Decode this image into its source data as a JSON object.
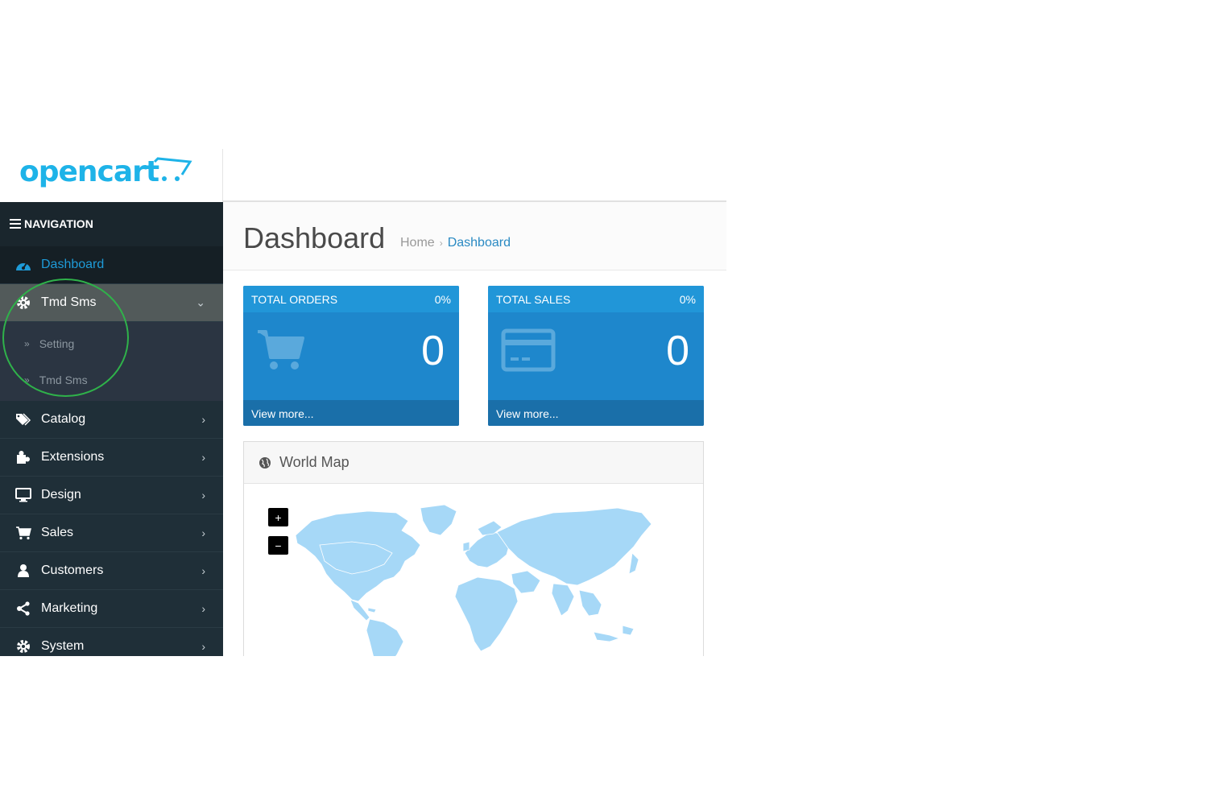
{
  "logo": {
    "text": "opencart"
  },
  "sidebar": {
    "nav_title": "NAVIGATION",
    "items": [
      {
        "label": "Dashboard",
        "icon": "dashboard-icon"
      },
      {
        "label": "Tmd Sms",
        "icon": "gear-icon"
      },
      {
        "label": "Catalog",
        "icon": "tags-icon"
      },
      {
        "label": "Extensions",
        "icon": "puzzle-icon"
      },
      {
        "label": "Design",
        "icon": "monitor-icon"
      },
      {
        "label": "Sales",
        "icon": "cart-icon"
      },
      {
        "label": "Customers",
        "icon": "user-icon"
      },
      {
        "label": "Marketing",
        "icon": "share-icon"
      },
      {
        "label": "System",
        "icon": "gear-icon"
      }
    ],
    "submenu": [
      {
        "label": "Setting"
      },
      {
        "label": "Tmd Sms"
      }
    ]
  },
  "page": {
    "title": "Dashboard",
    "breadcrumb": {
      "home": "Home",
      "separator": "›",
      "current": "Dashboard"
    }
  },
  "tiles": [
    {
      "title": "TOTAL ORDERS",
      "percent": "0%",
      "value": "0",
      "link": "View more...",
      "icon": "cart-icon"
    },
    {
      "title": "TOTAL SALES",
      "percent": "0%",
      "value": "0",
      "link": "View more...",
      "icon": "credit-card-icon"
    }
  ],
  "map": {
    "title": "World Map",
    "zoom_in": "+",
    "zoom_out": "−"
  },
  "colors": {
    "brand": "#1eb3e8",
    "sidebar_bg": "#1f2f38",
    "active_link": "#1e9bd8",
    "tile_bg": "#1e87cc",
    "map_land": "#a6d8f7",
    "highlight_circle": "#2fb24a"
  }
}
